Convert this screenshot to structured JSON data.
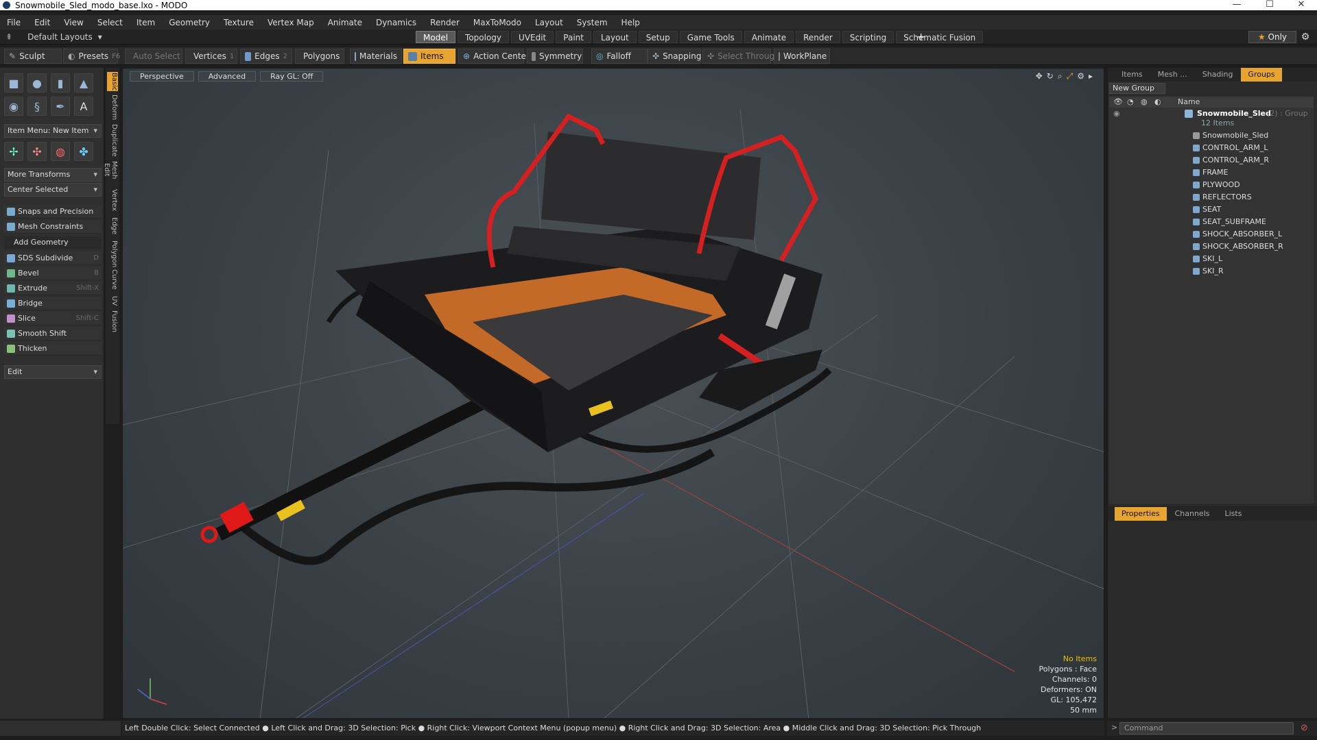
{
  "window": {
    "title": "Snowmobile_Sled_modo_base.lxo - MODO"
  },
  "menu": [
    "File",
    "Edit",
    "View",
    "Select",
    "Item",
    "Geometry",
    "Texture",
    "Vertex Map",
    "Animate",
    "Dynamics",
    "Render",
    "MaxToModo",
    "Layout",
    "System",
    "Help"
  ],
  "layout": {
    "name": "Default Layouts",
    "tabs": [
      "Model",
      "Topology",
      "UVEdit",
      "Paint",
      "Layout",
      "Setup",
      "Game Tools",
      "Animate",
      "Render",
      "Scripting",
      "Schematic Fusion"
    ],
    "active_tab": "Model",
    "only_label": "Only"
  },
  "toolbar": {
    "sculpt": "Sculpt",
    "presets": "Presets",
    "presets_shortcut": "F6",
    "auto_select": "Auto Select",
    "vertices": "Vertices",
    "vertices_num": "1",
    "edges": "Edges",
    "edges_num": "2",
    "polygons": "Polygons",
    "materials": "Materials",
    "items": "Items",
    "action_center": "Action Center",
    "symmetry": "Symmetry",
    "falloff": "Falloff",
    "snapping": "Snapping",
    "select_through": "Select Through",
    "workplane": "WorkPlane"
  },
  "leftpanel": {
    "item_menu": "Item Menu: New Item",
    "more_transforms": "More Transforms",
    "center_selected": "Center Selected",
    "snaps": "Snaps and Precision",
    "mesh_constraints": "Mesh Constraints",
    "add_geometry": "Add Geometry",
    "tools": [
      {
        "label": "SDS Subdivide",
        "shortcut": "D",
        "color": "#7aa7d3"
      },
      {
        "label": "Bevel",
        "shortcut": "B",
        "color": "#6fb88a"
      },
      {
        "label": "Extrude",
        "shortcut": "Shift-X",
        "color": "#6fb8b0"
      },
      {
        "label": "Bridge",
        "shortcut": "",
        "color": "#7ab0d8"
      },
      {
        "label": "Slice",
        "shortcut": "Shift-C",
        "color": "#c48ec9"
      },
      {
        "label": "Smooth Shift",
        "shortcut": "",
        "color": "#7ac3b0"
      },
      {
        "label": "Thicken",
        "shortcut": "",
        "color": "#8fc07a"
      }
    ],
    "edit": "Edit",
    "vtabs": [
      "Basic",
      "Deform",
      "Duplicate",
      "Mesh Edit",
      "Vertex",
      "Edge",
      "Polygon",
      "Curve",
      "UV",
      "Fusion"
    ]
  },
  "viewport": {
    "perspective": "Perspective",
    "advanced": "Advanced",
    "raygl": "Ray GL: Off",
    "info": {
      "no_items": "No Items",
      "polygons": "Polygons : Face",
      "channels": "Channels: 0",
      "deformers": "Deformers: ON",
      "gl": "GL: 105,472",
      "scale": "50 mm"
    }
  },
  "rightpanel": {
    "tabs": [
      "Items",
      "Mesh ...",
      "Shading",
      "Groups"
    ],
    "active_tab": "Groups",
    "new_group": "New Group",
    "name_header": "Name",
    "group": {
      "name": "Snowmobile_Sled",
      "suffix": "(2) : Group",
      "count": "12 Items"
    },
    "items": [
      "Snowmobile_Sled",
      "CONTROL_ARM_L",
      "CONTROL_ARM_R",
      "FRAME",
      "PLYWOOD",
      "REFLECTORS",
      "SEAT",
      "SEAT_SUBFRAME",
      "SHOCK_ABSORBER_L",
      "SHOCK_ABSORBER_R",
      "SKI_L",
      "SKI_R"
    ]
  },
  "properties": {
    "tabs": [
      "Properties",
      "Channels",
      "Lists"
    ],
    "active_tab": "Properties"
  },
  "status": {
    "text": "Left Double Click: Select Connected ● Left Click and Drag: 3D Selection: Pick ● Right Click: Viewport Context Menu (popup menu) ● Right Click and Drag: 3D Selection: Area ● Middle Click and Drag: 3D Selection: Pick Through"
  },
  "command": {
    "placeholder": "Command"
  }
}
